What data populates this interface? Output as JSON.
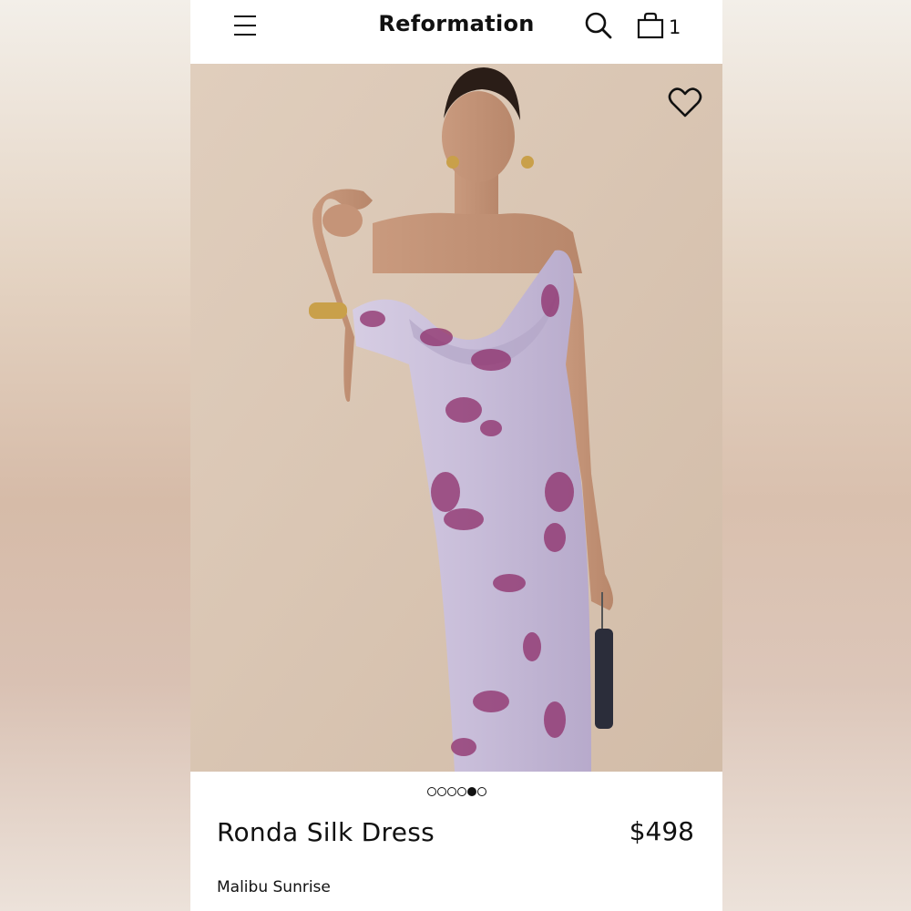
{
  "header": {
    "brand": "Reformation",
    "cart_count": "1",
    "icons": [
      "menu-icon",
      "search-icon",
      "bag-icon"
    ]
  },
  "gallery": {
    "wishlist_icon": "heart-icon",
    "dots_total": 6,
    "active_index": 4
  },
  "product": {
    "name": "Ronda Silk Dress",
    "price": "$498",
    "color": "Malibu Sunrise"
  },
  "colors": {
    "background": "#d8c4b2",
    "dress": "#c9bcd8",
    "print": "#8e2e6a",
    "text": "#111111"
  }
}
